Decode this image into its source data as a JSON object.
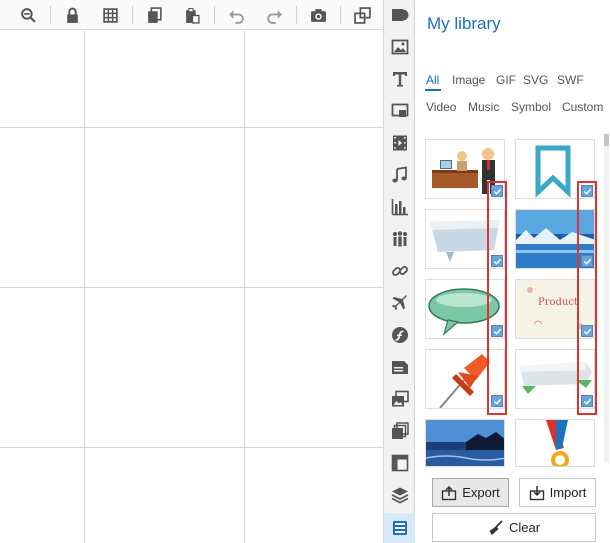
{
  "toolbar": {
    "buttons": [
      "zoom-out-icon",
      "lock-icon",
      "grid-icon",
      "copy-icon",
      "paste-icon",
      "undo-icon",
      "redo-icon",
      "camera-icon",
      "resize-icon"
    ]
  },
  "library": {
    "title": "My library",
    "tabs_row1": [
      "All",
      "Image",
      "GIF",
      "SVG",
      "SWF"
    ],
    "tabs_row2": [
      "Video",
      "Music",
      "Symbol",
      "Custom"
    ],
    "active_tab": "All",
    "items": [
      {
        "name": "people-at-desk",
        "checked": true
      },
      {
        "name": "bookmark-ribbon",
        "checked": true
      },
      {
        "name": "banner-speech",
        "checked": true
      },
      {
        "name": "blue-lake-landscape",
        "checked": true
      },
      {
        "name": "green-speech-bubble",
        "checked": true
      },
      {
        "name": "product-card",
        "checked": true,
        "text": "Product"
      },
      {
        "name": "red-pushpin",
        "checked": true
      },
      {
        "name": "green-banner",
        "checked": true
      },
      {
        "name": "sea-rocks-landscape",
        "checked": false
      },
      {
        "name": "medal-ribbon",
        "checked": false
      }
    ]
  },
  "buttons": {
    "export_label": "Export",
    "import_label": "Import",
    "clear_label": "Clear"
  },
  "colors": {
    "accent": "#1a6fc0",
    "highlight_red": "#e0322e",
    "check_blue": "#6aa3d8"
  }
}
